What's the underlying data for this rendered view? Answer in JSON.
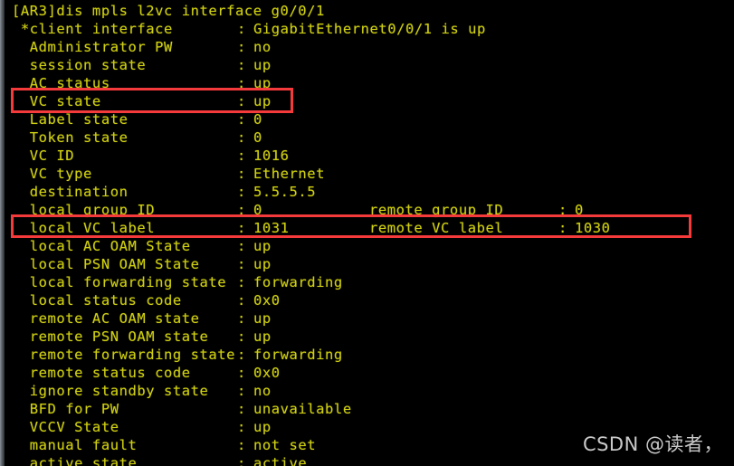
{
  "terminal": {
    "prompt_line": "[AR3]dis mpls l2vc interface g0/0/1",
    "colors": {
      "background": "#000000",
      "text": "#cfcf12",
      "annotation": "#f43a3a",
      "window_edge": "#5c6268",
      "watermark": "#c9c9c9"
    },
    "rows": [
      {
        "key": " *client interface",
        "colon": ":",
        "value": "GigabitEthernet0/0/1 is up"
      },
      {
        "key": "  Administrator PW",
        "colon": ":",
        "value": "no"
      },
      {
        "key": "  session state",
        "colon": ":",
        "value": "up"
      },
      {
        "key": "  AC status",
        "colon": ":",
        "value": "up"
      },
      {
        "key": "  VC state",
        "colon": ":",
        "value": "up"
      },
      {
        "key": "  Label state",
        "colon": ":",
        "value": "0"
      },
      {
        "key": "  Token state",
        "colon": ":",
        "value": "0"
      },
      {
        "key": "  VC ID",
        "colon": ":",
        "value": "1016"
      },
      {
        "key": "  VC type",
        "colon": ":",
        "value": "Ethernet"
      },
      {
        "key": "  destination",
        "colon": ":",
        "value": "5.5.5.5"
      },
      {
        "key": "  local group ID",
        "colon": ":",
        "value": "0",
        "rkey": "remote group ID",
        "rcolon": ":",
        "rvalue": "0"
      },
      {
        "key": "  local VC label",
        "colon": ":",
        "value": "1031",
        "rkey": "remote VC label",
        "rcolon": ":",
        "rvalue": "1030"
      },
      {
        "key": "  local AC OAM State",
        "colon": ":",
        "value": "up"
      },
      {
        "key": "  local PSN OAM State",
        "colon": ":",
        "value": "up"
      },
      {
        "key": "  local forwarding state",
        "colon": ":",
        "value": "forwarding"
      },
      {
        "key": "  local status code",
        "colon": ":",
        "value": "0x0"
      },
      {
        "key": "  remote AC OAM state",
        "colon": ":",
        "value": "up"
      },
      {
        "key": "  remote PSN OAM state",
        "colon": ":",
        "value": "up"
      },
      {
        "key": "  remote forwarding state",
        "colon": ":",
        "value": "forwarding"
      },
      {
        "key": "  remote status code",
        "colon": ":",
        "value": "0x0"
      },
      {
        "key": "  ignore standby state",
        "colon": ":",
        "value": "no"
      },
      {
        "key": "  BFD for PW",
        "colon": ":",
        "value": "unavailable"
      },
      {
        "key": "  VCCV State",
        "colon": ":",
        "value": "up"
      },
      {
        "key": "  manual fault",
        "colon": ":",
        "value": "not set"
      },
      {
        "key": "  active state",
        "colon": ":",
        "value": "active"
      }
    ]
  },
  "annotations": [
    {
      "name": "vc-state-highlight",
      "target": "VC state : up"
    },
    {
      "name": "vc-label-highlight",
      "target": "local VC label : 1031   remote VC label : 1030"
    }
  ],
  "watermark": {
    "text": "CSDN @读者，"
  }
}
